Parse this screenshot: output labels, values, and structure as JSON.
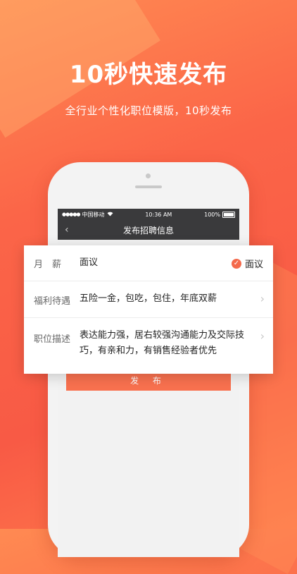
{
  "hero": {
    "title": "10秒快速发布",
    "subtitle": "全行业个性化职位模版，10秒发布"
  },
  "status_bar": {
    "carrier": "中国移动",
    "time": "10:36 AM",
    "battery": "100%"
  },
  "nav": {
    "title": "发布招聘信息",
    "back_icon": "chevron-left-icon"
  },
  "form": {
    "salary": {
      "label": "月　薪",
      "value": "面议",
      "option_label": "面议",
      "option_checked": true
    },
    "benefits": {
      "label": "福利待遇",
      "value": "五险一金，包吃，包住，年底双薪"
    },
    "description": {
      "label": "职位描述",
      "value": "表达能力强，居右较强沟通能力及交际技巧，有亲和力，有销售经验者优先"
    }
  },
  "publish_button": "发 布",
  "colors": {
    "accent": "#f9714f",
    "nav_bg": "#3a3a3c"
  }
}
